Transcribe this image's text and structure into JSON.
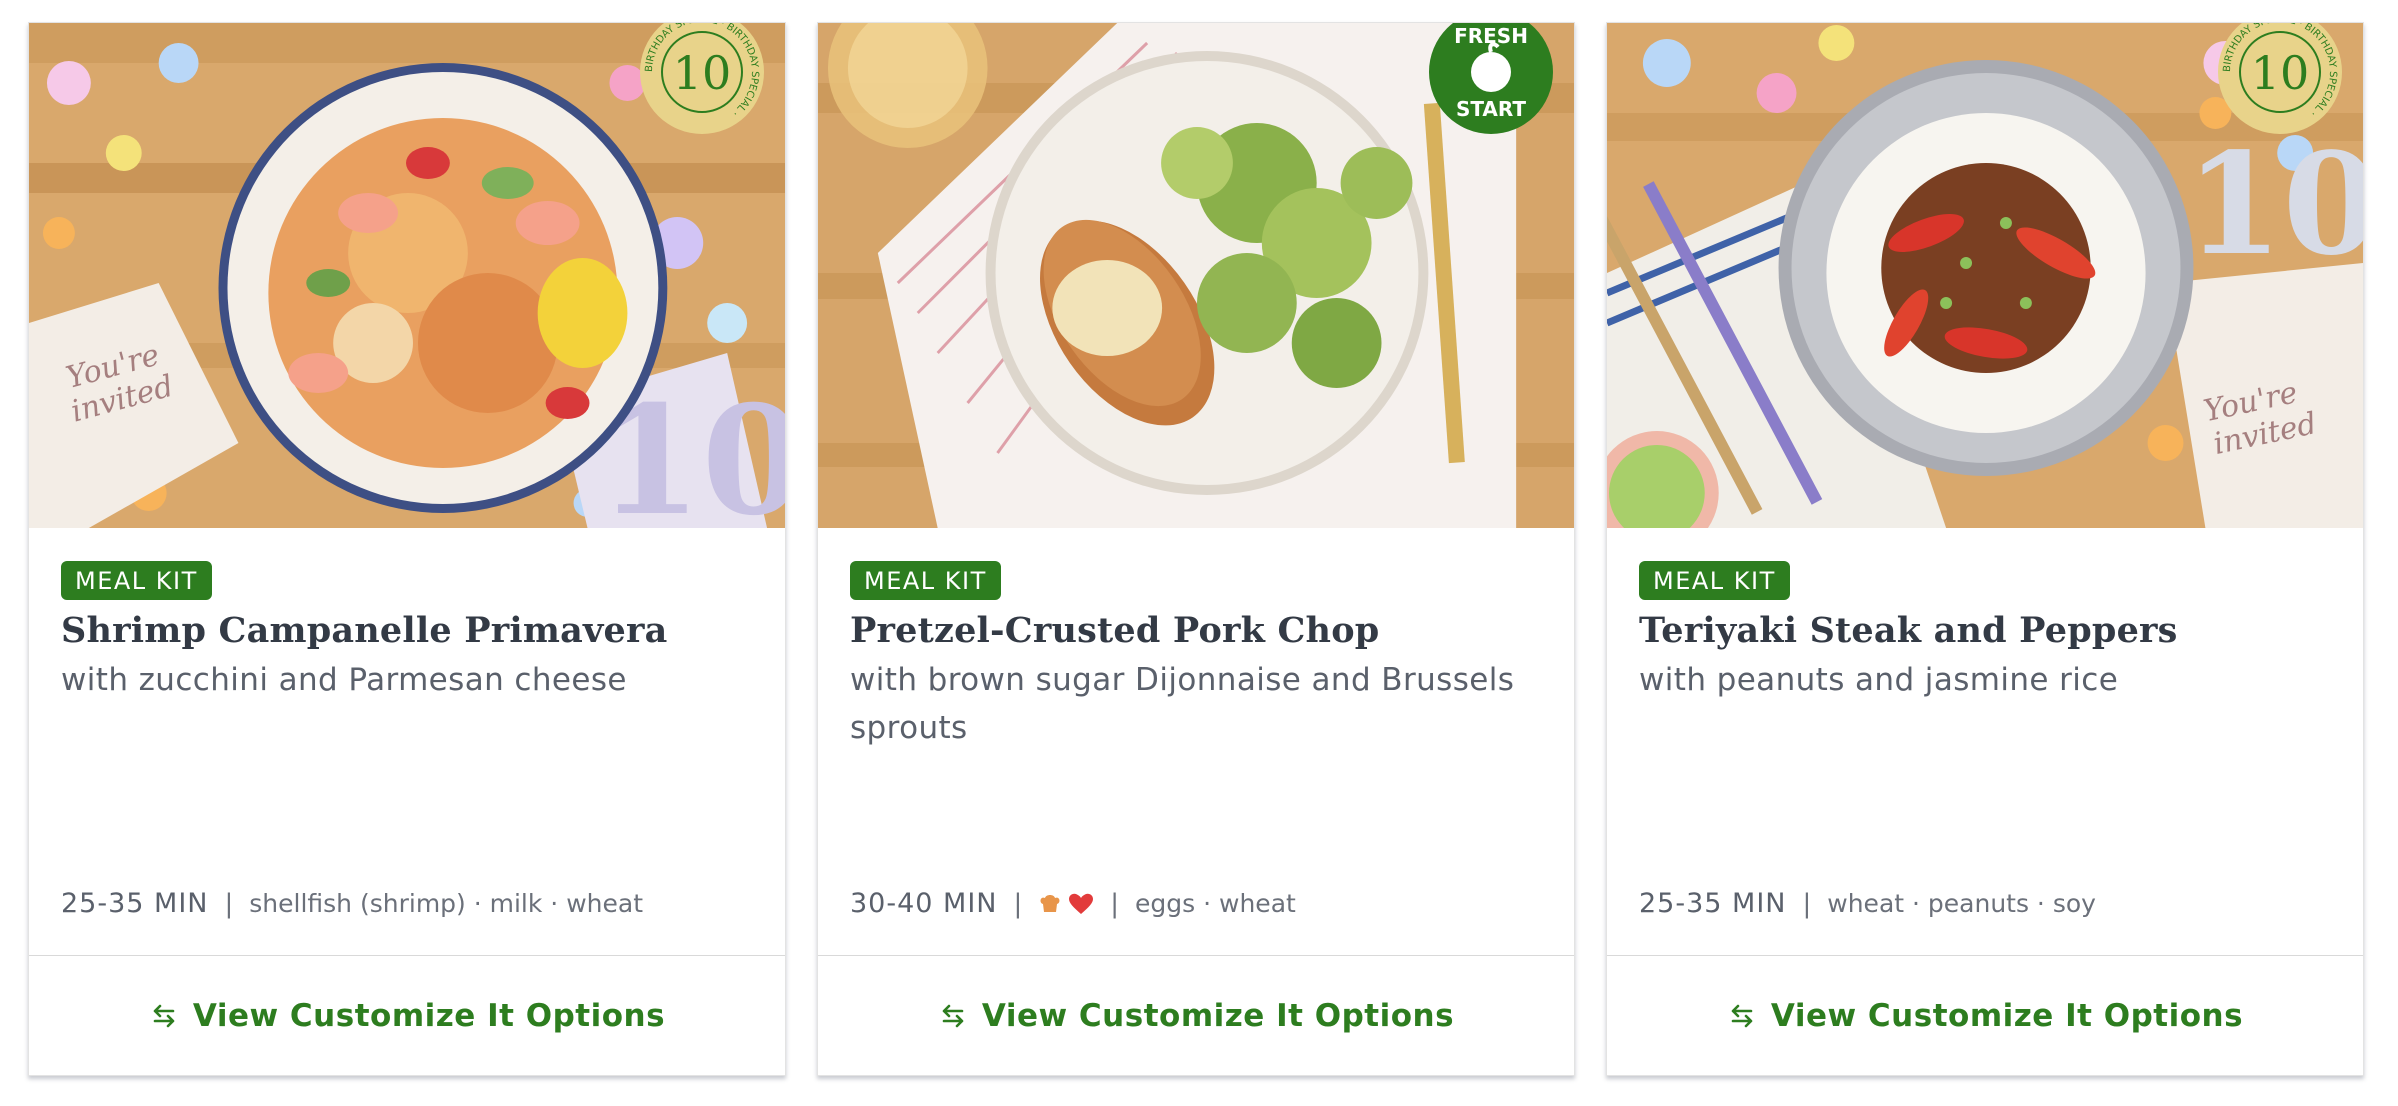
{
  "cards": [
    {
      "tag": "MEAL KIT",
      "title": "Shrimp Campanelle Primavera",
      "subtitle": "with zucchini and Parmesan cheese",
      "time": "25-35 MIN",
      "allergens": "shellfish (shrimp) · milk · wheat",
      "badge": {
        "ring_text": "BIRTHDAY SPECIAL · BIRTHDAY SPECIAL ·",
        "number": "10",
        "icon": "birthday-special-badge-icon"
      },
      "photo_icon": "shrimp-pasta-photo",
      "cta": "View Customize It Options"
    },
    {
      "tag": "MEAL KIT",
      "title": "Pretzel-Crusted Pork Chop",
      "subtitle": "with brown sugar Dijonnaise and Brussels sprouts",
      "time": "30-40 MIN",
      "diet_icons": [
        "chef-hat-icon",
        "heart-icon"
      ],
      "allergens": "eggs · wheat",
      "badge": {
        "top": "FRESH",
        "bottom": "START",
        "icon": "fresh-start-badge-icon"
      },
      "photo_icon": "pork-chop-photo",
      "cta": "View Customize It Options"
    },
    {
      "tag": "MEAL KIT",
      "title": "Teriyaki Steak and Peppers",
      "subtitle": "with peanuts and jasmine rice",
      "time": "25-35 MIN",
      "allergens": "wheat · peanuts · soy",
      "badge": {
        "ring_text": "BIRTHDAY SPECIAL · BIRTHDAY SPECIAL ·",
        "number": "10",
        "icon": "birthday-special-badge-icon"
      },
      "photo_icon": "teriyaki-steak-photo",
      "cta": "View Customize It Options"
    }
  ],
  "colors": {
    "brand_green": "#2d7d1f",
    "badge_gold": "#e8d38a",
    "heart_red": "#e23b3b",
    "hat_orange": "#e8954a"
  }
}
